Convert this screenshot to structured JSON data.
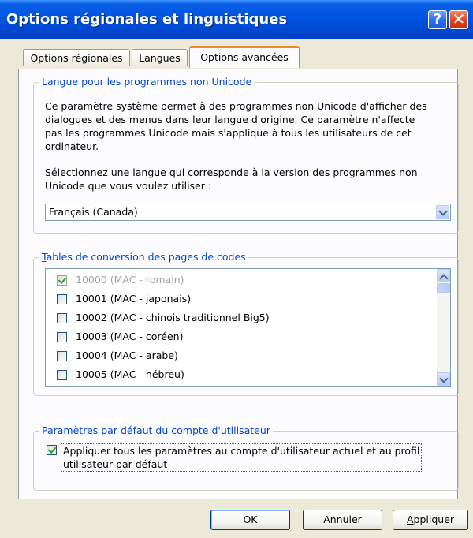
{
  "window": {
    "title": "Options régionales et linguistiques",
    "help_button": "?",
    "close_button": "✕"
  },
  "tabs": [
    {
      "label": "Options régionales",
      "active": false
    },
    {
      "label": "Langues",
      "active": false
    },
    {
      "label": "Options avancées",
      "active": true
    }
  ],
  "non_unicode": {
    "legend": "Langue pour les programmes non Unicode",
    "description_lines": [
      "Ce paramètre système permet à des programmes non Unicode d'afficher des",
      "dialogues et des menus dans leur langue d'origine. Ce paramètre n'affecte",
      "pas les programmes Unicode mais s'applique à tous les utilisateurs de cet",
      "ordinateur."
    ],
    "select_prompt_mnemonic": "S",
    "select_prompt_line1_rest": "électionnez une langue qui corresponde à la version des programmes non",
    "select_prompt_line2": "Unicode que vous voulez utiliser :",
    "selected_language": "Français (Canada)"
  },
  "code_pages": {
    "legend_mnemonic": "T",
    "legend_rest": "ables de conversion des pages de codes",
    "items": [
      {
        "label": "10000 (MAC - romain)",
        "checked": true,
        "disabled": true
      },
      {
        "label": "10001 (MAC - japonais)",
        "checked": false,
        "disabled": false
      },
      {
        "label": "10002 (MAC - chinois traditionnel Big5)",
        "checked": false,
        "disabled": false
      },
      {
        "label": "10003 (MAC - coréen)",
        "checked": false,
        "disabled": false
      },
      {
        "label": "10004 (MAC - arabe)",
        "checked": false,
        "disabled": false
      },
      {
        "label": "10005 (MAC - hébreu)",
        "checked": false,
        "disabled": false
      }
    ]
  },
  "user_defaults": {
    "legend": "Paramètres par défaut du compte d'utilisateur",
    "checkbox_line1": "Appliquer tous les paramètres au compte d'utilisateur actuel et au profil",
    "checkbox_line2": "utilisateur par défaut",
    "checked": true
  },
  "buttons": {
    "ok": "OK",
    "cancel": "Annuler",
    "apply_mnemonic": "A",
    "apply_rest": "ppliquer"
  },
  "colors": {
    "titlebar": "#0054e3",
    "legend_text": "#0046d5",
    "active_tab_accent": "#e68b2c",
    "dialog_background": "#ece9d8"
  }
}
